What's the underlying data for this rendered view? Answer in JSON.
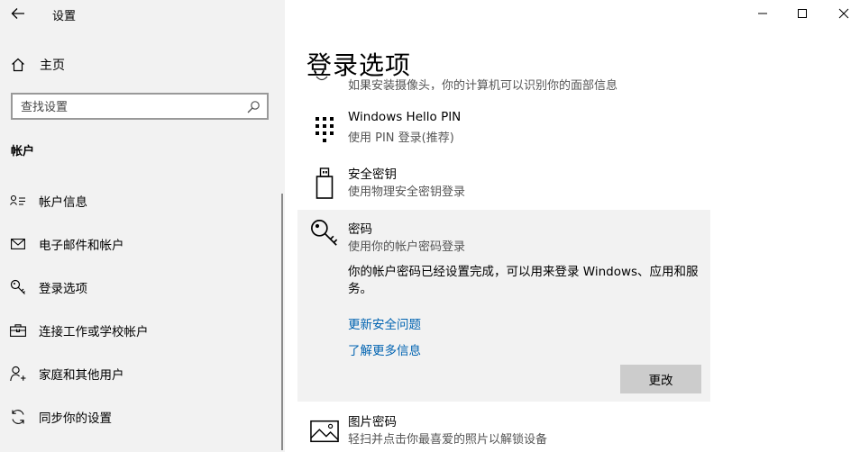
{
  "window": {
    "title": "设置",
    "controls": {
      "minimize_icon": "minimize-icon",
      "maximize_icon": "maximize-icon",
      "close_icon": "close-icon"
    }
  },
  "sidebar": {
    "home_label": "主页",
    "search": {
      "placeholder": "查找设置",
      "icon": "search-icon"
    },
    "section_header": "帐户",
    "items": [
      {
        "label": "帐户信息",
        "icon": "person-card-icon"
      },
      {
        "label": "电子邮件和帐户",
        "icon": "mail-icon"
      },
      {
        "label": "登录选项",
        "icon": "key-icon"
      },
      {
        "label": "连接工作或学校帐户",
        "icon": "briefcase-icon"
      },
      {
        "label": "家庭和其他用户",
        "icon": "person-add-icon"
      },
      {
        "label": "同步你的设置",
        "icon": "sync-icon"
      }
    ]
  },
  "main": {
    "title": "登录选项",
    "clipped_text": "如果安装摄像头，你的计算机可以识别你的面部信息",
    "options": {
      "pin": {
        "title": "Windows Hello PIN",
        "subtitle": "使用 PIN 登录(推荐)",
        "icon": "pin-keypad-icon"
      },
      "security_key": {
        "title": "安全密钥",
        "subtitle": "使用物理安全密钥登录",
        "icon": "usb-key-icon"
      },
      "password": {
        "title": "密码",
        "subtitle": "使用你的帐户密码登录",
        "icon": "key-icon",
        "description": "你的帐户密码已经设置完成，可以用来登录 Windows、应用和服务。",
        "link_update": "更新安全问题",
        "link_more": "了解更多信息",
        "change_button": "更改"
      },
      "picture_password": {
        "title": "图片密码",
        "subtitle": "轻扫并点击你最喜爱的照片以解锁设备",
        "icon": "picture-icon"
      }
    }
  }
}
